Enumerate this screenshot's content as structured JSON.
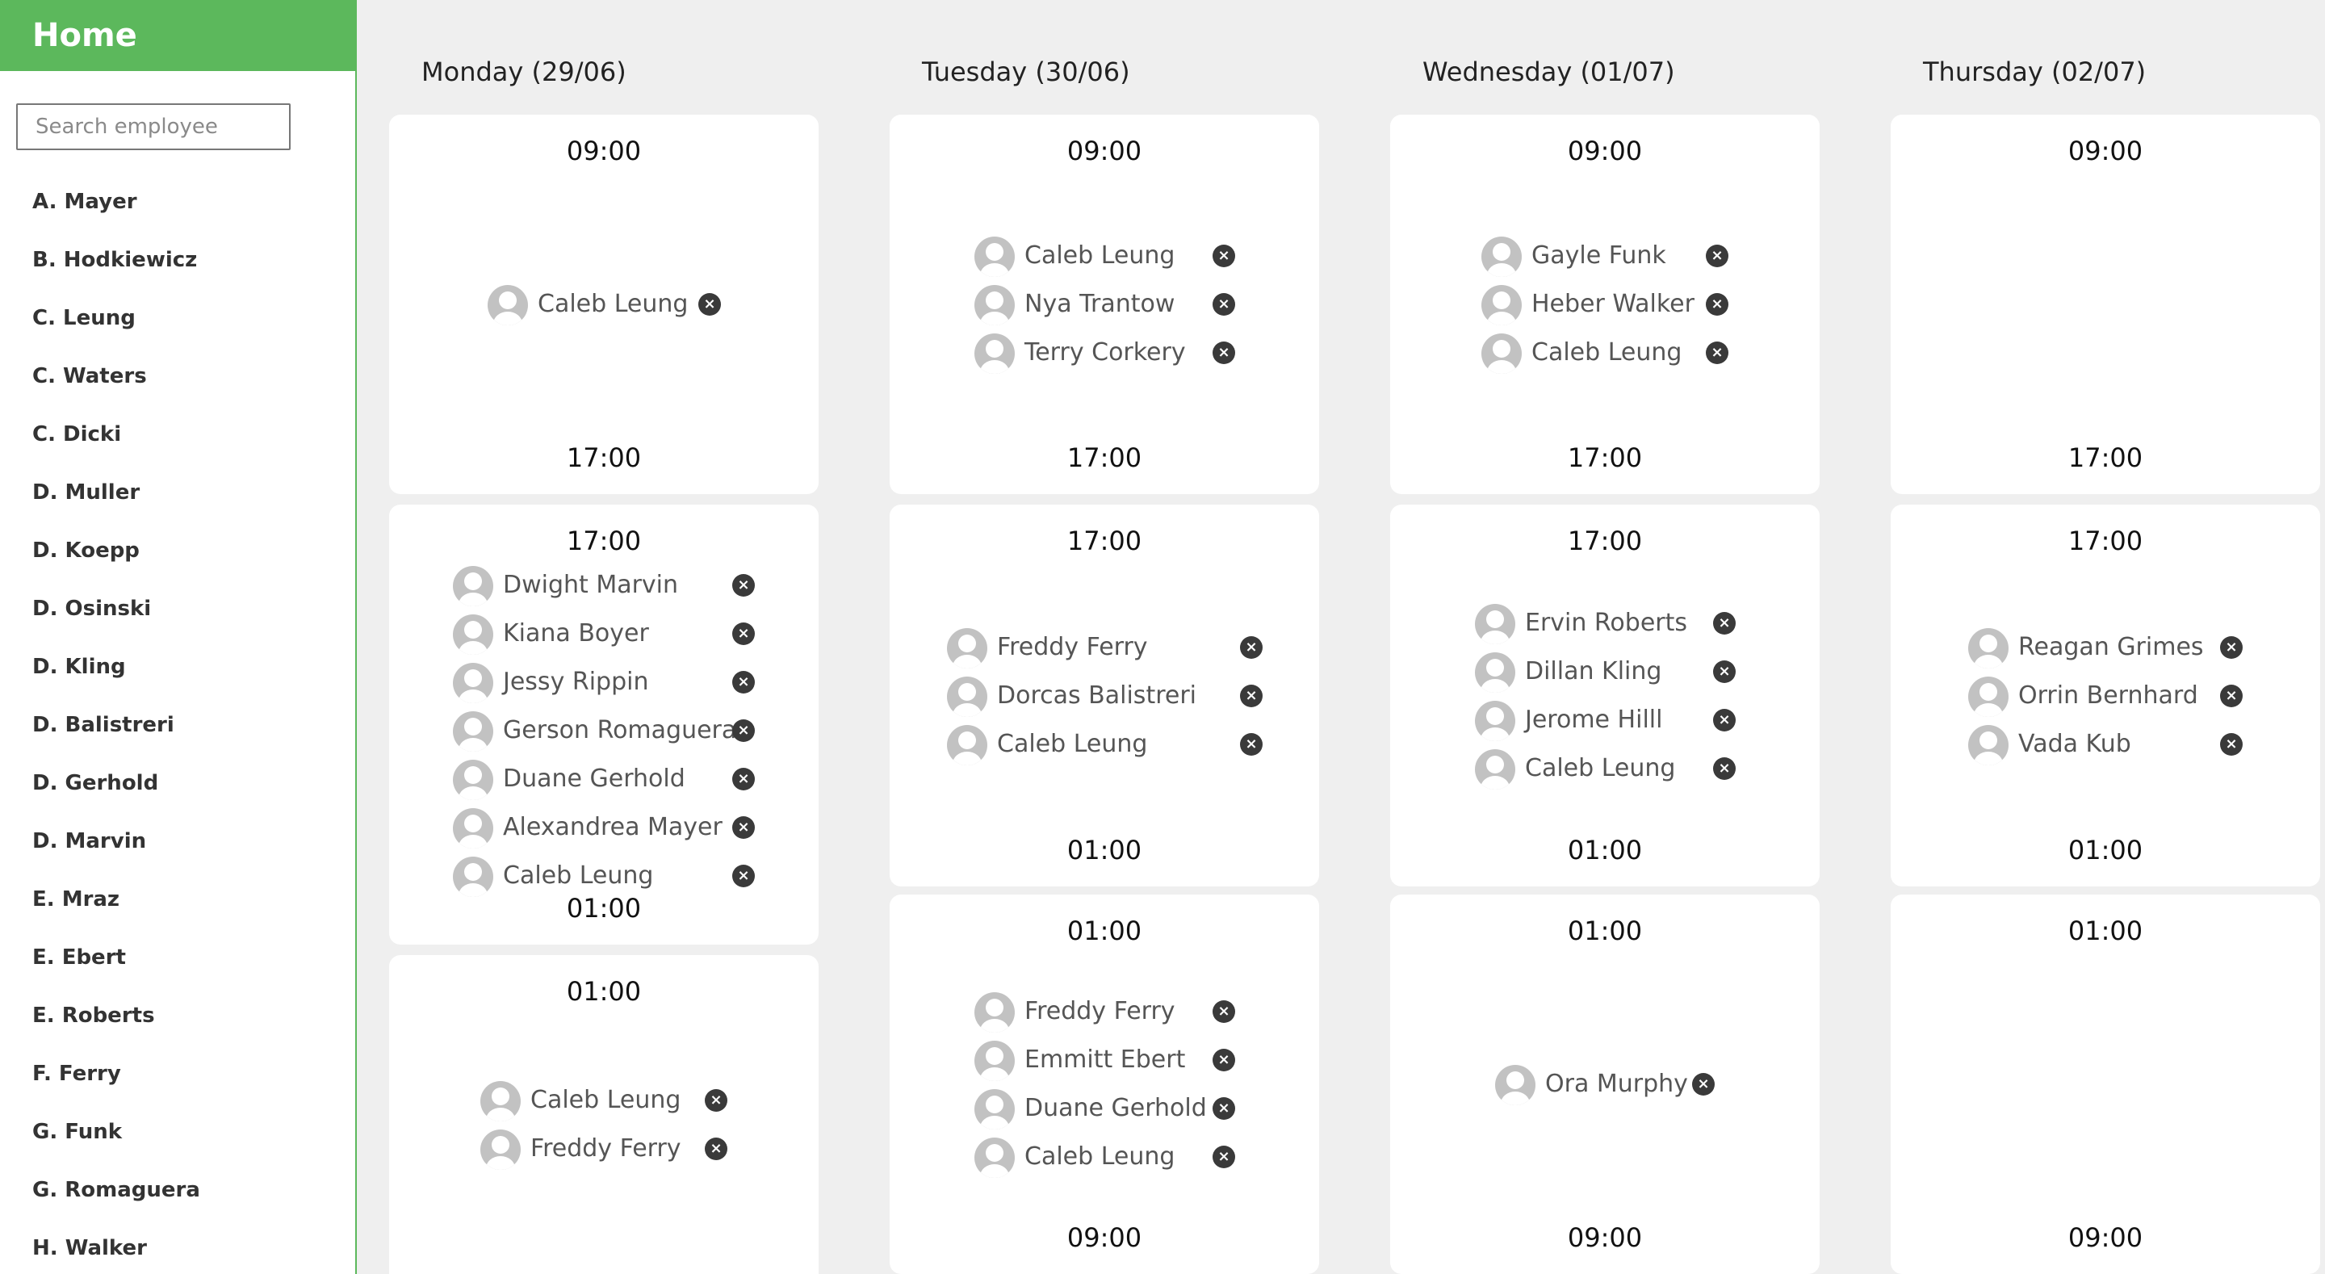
{
  "sidebar": {
    "title": "Home",
    "search_placeholder": "Search employee",
    "employees": [
      "A. Mayer",
      "B. Hodkiewicz",
      "C. Leung",
      "C. Waters",
      "C. Dicki",
      "D. Muller",
      "D. Koepp",
      "D. Osinski",
      "D. Kling",
      "D. Balistreri",
      "D. Gerhold",
      "D. Marvin",
      "E. Mraz",
      "E. Ebert",
      "E. Roberts",
      "F. Ferry",
      "G. Funk",
      "G. Romaguera",
      "H. Walker"
    ]
  },
  "days": [
    {
      "title": "Monday (29/06)",
      "shifts": [
        {
          "start": "09:00",
          "end": "17:00",
          "employees": [
            "Caleb Leung"
          ]
        },
        {
          "start": "17:00",
          "end": "01:00",
          "employees": [
            "Dwight Marvin",
            "Kiana Boyer",
            "Jessy Rippin",
            "Gerson Romaguera",
            "Duane Gerhold",
            "Alexandrea Mayer",
            "Caleb Leung"
          ]
        },
        {
          "start": "01:00",
          "end": "",
          "employees": [
            "Caleb Leung",
            "Freddy Ferry"
          ]
        }
      ]
    },
    {
      "title": "Tuesday (30/06)",
      "shifts": [
        {
          "start": "09:00",
          "end": "17:00",
          "employees": [
            "Caleb Leung",
            "Nya Trantow",
            "Terry Corkery"
          ]
        },
        {
          "start": "17:00",
          "end": "01:00",
          "employees": [
            "Freddy Ferry",
            "Dorcas Balistreri",
            "Caleb Leung"
          ]
        },
        {
          "start": "01:00",
          "end": "09:00",
          "employees": [
            "Freddy Ferry",
            "Emmitt Ebert",
            "Duane Gerhold",
            "Caleb Leung"
          ]
        }
      ]
    },
    {
      "title": "Wednesday (01/07)",
      "shifts": [
        {
          "start": "09:00",
          "end": "17:00",
          "employees": [
            "Gayle Funk",
            "Heber Walker",
            "Caleb Leung"
          ]
        },
        {
          "start": "17:00",
          "end": "01:00",
          "employees": [
            "Ervin Roberts",
            "Dillan Kling",
            "Jerome Hilll",
            "Caleb Leung"
          ]
        },
        {
          "start": "01:00",
          "end": "09:00",
          "employees": [
            "Ora Murphy"
          ]
        }
      ]
    },
    {
      "title": "Thursday (02/07)",
      "shifts": [
        {
          "start": "09:00",
          "end": "17:00",
          "employees": []
        },
        {
          "start": "17:00",
          "end": "01:00",
          "employees": [
            "Reagan Grimes",
            "Orrin Bernhard",
            "Vada Kub"
          ]
        },
        {
          "start": "01:00",
          "end": "09:00",
          "employees": []
        }
      ]
    }
  ]
}
